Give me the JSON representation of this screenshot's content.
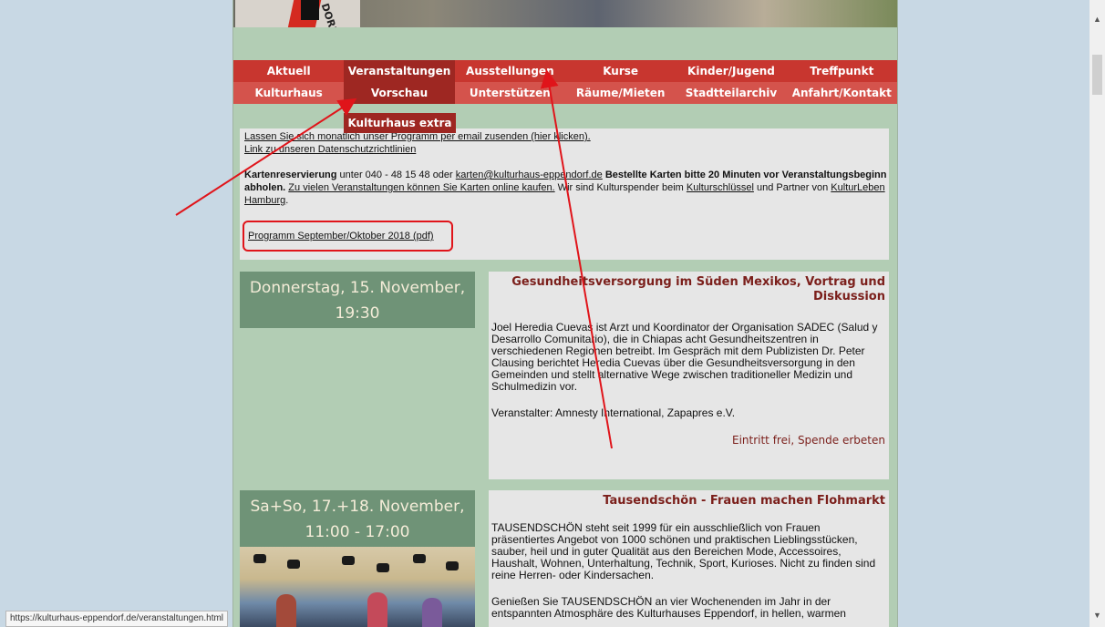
{
  "nav": {
    "row1": [
      "Aktuell",
      "Veranstaltungen",
      "Ausstellungen",
      "Kurse",
      "Kinder/Jugend",
      "Treffpunkt"
    ],
    "row2": [
      "Kulturhaus",
      "Vorschau",
      "Unterstützen",
      "Räume/Mieten",
      "Stadtteilarchiv",
      "Anfahrt/Kontakt"
    ],
    "dropdown_extra": "Kulturhaus extra"
  },
  "info": {
    "newsletter_link": "Lassen Sie sich monatlich unser Programm per email zusenden (hier klicken).",
    "privacy_link": "Link zu unseren Datenschutzrichtlinien",
    "reservation_label": "Kartenreservierung",
    "reservation_phone": " unter 040 - 48 15 48 oder ",
    "reservation_email": "karten@kulturhaus-eppendorf.de",
    "reservation_note": " Bestellte Karten bitte 20 Minuten vor Veranstaltungsbeginn abholen.",
    "online_link": "Zu vielen Veranstaltungen können Sie Karten online kaufen.",
    "sponsor_text": " Wir sind Kulturspender beim ",
    "sponsor_link": "Kulturschlüssel",
    "partner_text": "und Partner von ",
    "partner_link": "KulturLeben Hamburg",
    "pdf_link": "Programm September/Oktober 2018 (pdf)"
  },
  "events": [
    {
      "date": "Donnerstag, 15. November, 19:30",
      "title": "Gesundheitsversorgung im Süden Mexikos, Vortrag und Diskussion",
      "body1": "Joel Heredia Cuevas ist Arzt und Koordinator der Organisation SADEC (Salud y Desarrollo Comunitario), die in Chiapas acht Gesundheitszentren in verschiedenen Regionen betreibt. Im Gespräch mit dem Publizisten Dr. Peter Clausing berichtet Heredia Cuevas über die Gesundheitsversorgung in den Gemeinden und stellt alternative Wege zwischen traditioneller Medizin und Schulmedizin vor.",
      "body2": "Veranstalter: Amnesty International, Zapapres e.V.",
      "footer": "Eintritt frei, Spende erbeten"
    },
    {
      "date": "Sa+So, 17.+18. November, 11:00 - 17:00",
      "title": "Tausendschön - Frauen machen Flohmarkt",
      "body1": "TAUSENDSCHÖN steht seit 1999 für ein ausschließlich von Frauen präsentiertes Angebot von 1000 schönen und praktischen Lieblingsstücken, sauber, heil und in guter Qualität aus den Bereichen Mode, Accessoires, Haushalt, Wohnen, Unterhaltung, Technik, Sport, Kurioses. Nicht zu finden sind reine Herren- oder Kindersachen.",
      "body2": "Genießen Sie TAUSENDSCHÖN an vier Wochenenden im Jahr in der entspannten Atmosphäre des Kulturhauses Eppendorf, in hellen, warmen"
    }
  ],
  "status_url": "https://kulturhaus-eppendorf.de/veranstaltungen.html",
  "colors": {
    "nav_red": "#c8362f",
    "nav_active": "#9e2722",
    "date_green": "#6f9377",
    "page_green": "#b2cdb4",
    "annotation_red": "#e0141a"
  }
}
